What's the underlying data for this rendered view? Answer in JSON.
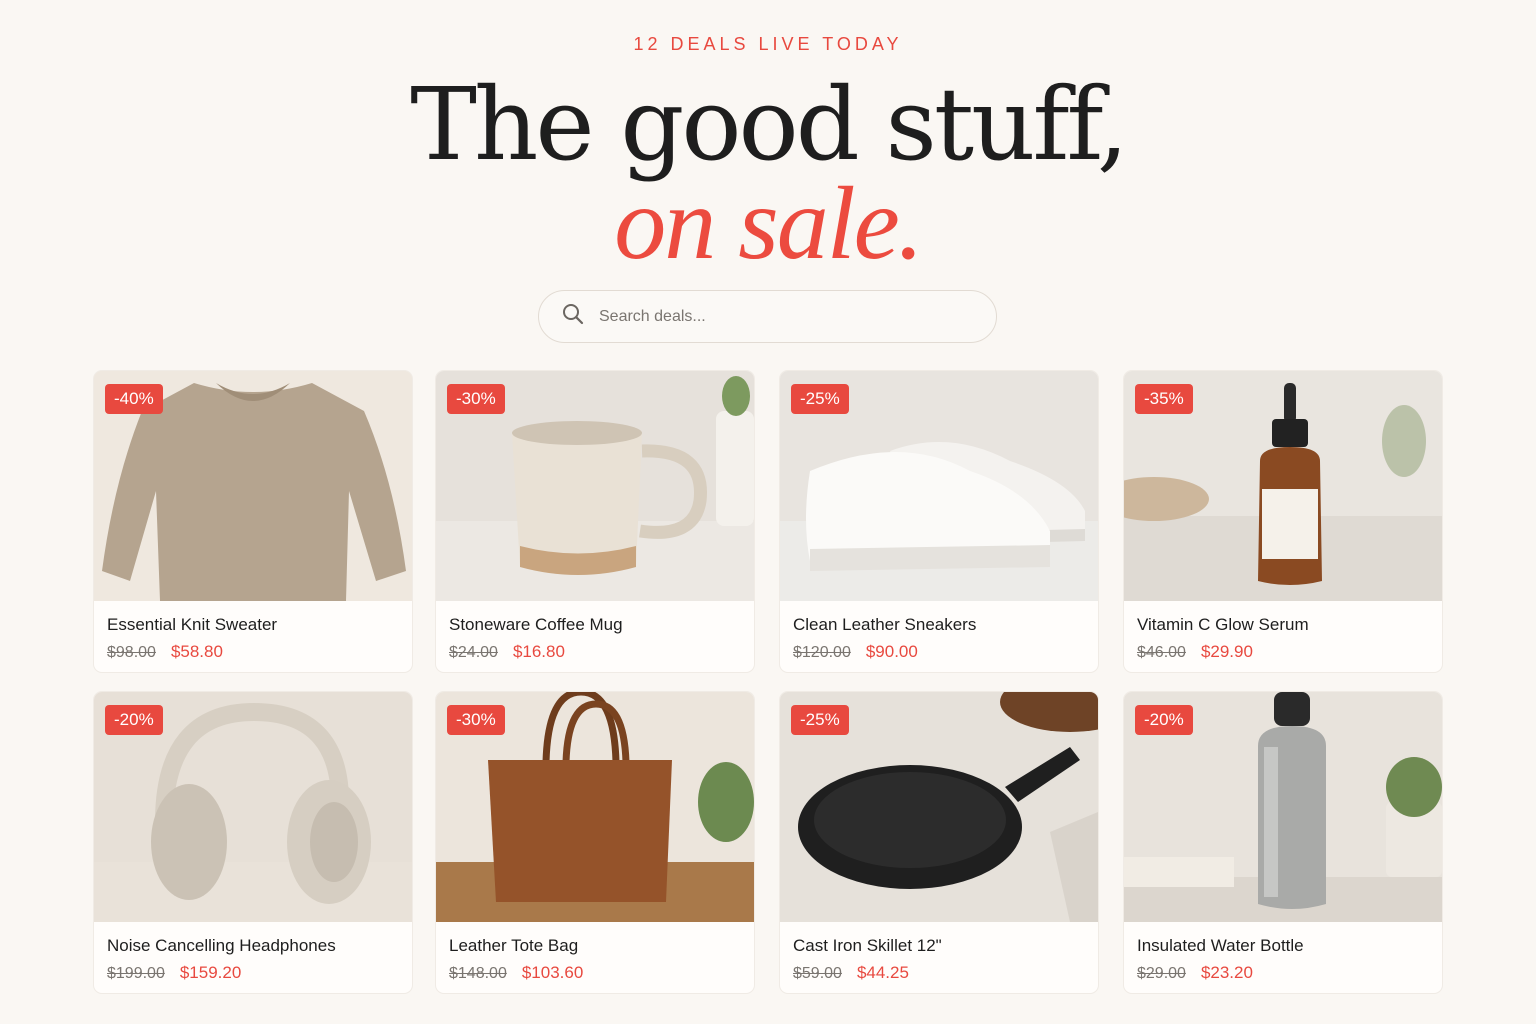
{
  "hero": {
    "eyebrow": "12 DEALS LIVE TODAY",
    "headline": "The good stuff,",
    "headline_accent": "on sale."
  },
  "search": {
    "placeholder": "Search deals...",
    "icon": "search-icon"
  },
  "colors": {
    "accent": "#e8493f",
    "background": "#faf7f3",
    "text": "#1e1e1e"
  },
  "products": [
    {
      "name": "Essential Knit Sweater",
      "discount": "-40%",
      "old_price": "$98.00",
      "price": "$58.80",
      "image": "sweater"
    },
    {
      "name": "Stoneware Coffee Mug",
      "discount": "-30%",
      "old_price": "$24.00",
      "price": "$16.80",
      "image": "mug"
    },
    {
      "name": "Clean Leather Sneakers",
      "discount": "-25%",
      "old_price": "$120.00",
      "price": "$90.00",
      "image": "sneakers"
    },
    {
      "name": "Vitamin C Glow Serum",
      "discount": "-35%",
      "old_price": "$46.00",
      "price": "$29.90",
      "image": "serum-bottle"
    },
    {
      "name": "Noise Cancelling Headphones",
      "discount": "-20%",
      "old_price": "$199.00",
      "price": "$159.20",
      "image": "headphones"
    },
    {
      "name": "Leather Tote Bag",
      "discount": "-30%",
      "old_price": "$148.00",
      "price": "$103.60",
      "image": "tote-bag"
    },
    {
      "name": "Cast Iron Skillet 12\"",
      "discount": "-25%",
      "old_price": "$59.00",
      "price": "$44.25",
      "image": "skillet"
    },
    {
      "name": "Insulated Water Bottle",
      "discount": "-20%",
      "old_price": "$29.00",
      "price": "$23.20",
      "image": "water-bottle"
    }
  ]
}
